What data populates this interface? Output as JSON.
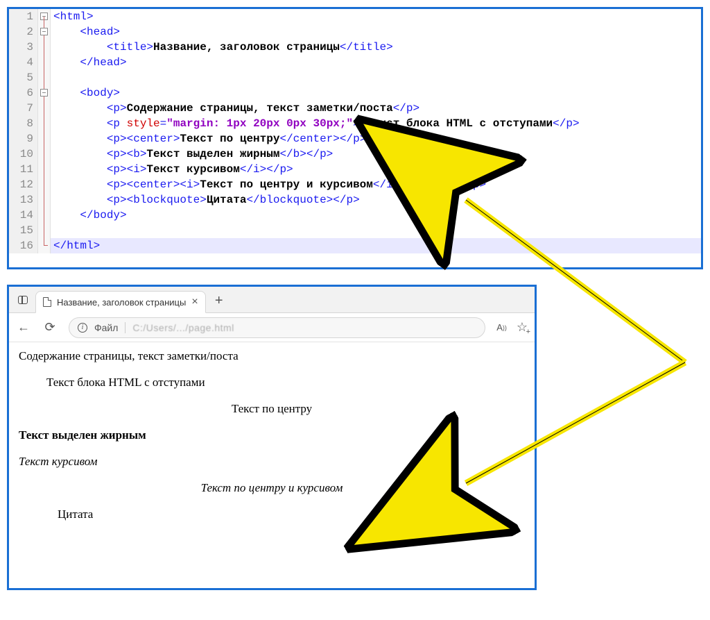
{
  "editor": {
    "lines": [
      {
        "n": "1",
        "html": "<span class='tag'>&lt;html&gt;</span>",
        "fold": "start"
      },
      {
        "n": "2",
        "html": "    <span class='tag'>&lt;head&gt;</span>",
        "fold": "start2"
      },
      {
        "n": "3",
        "html": "        <span class='tag'>&lt;title&gt;</span><span class='txt'>Название, заголовок страницы</span><span class='tag'>&lt;/title&gt;</span>",
        "fold": "mid"
      },
      {
        "n": "4",
        "html": "    <span class='tag'>&lt;/head&gt;</span>",
        "fold": "mid"
      },
      {
        "n": "5",
        "html": "",
        "fold": "mid"
      },
      {
        "n": "6",
        "html": "    <span class='tag'>&lt;body&gt;</span>",
        "fold": "start2"
      },
      {
        "n": "7",
        "html": "        <span class='tag'>&lt;p&gt;</span><span class='txt'>Содержание страницы, текст заметки/поста</span><span class='tag'>&lt;/p&gt;</span>",
        "fold": "mid"
      },
      {
        "n": "8",
        "html": "        <span class='tag'>&lt;p </span><span class='attr'>style</span><span class='tag'>=</span><span class='str'>\"margin: 1px 20px 0px 30px;\"</span><span class='tag'>&gt;</span><span class='txt'> Текст блока HTML с отступами</span><span class='tag'>&lt;/p&gt;</span>",
        "fold": "mid"
      },
      {
        "n": "9",
        "html": "        <span class='tag'>&lt;p&gt;&lt;center&gt;</span><span class='txt'>Текст по центру</span><span class='tag'>&lt;/center&gt;&lt;/p&gt;</span>",
        "fold": "mid"
      },
      {
        "n": "10",
        "html": "        <span class='tag'>&lt;p&gt;&lt;b&gt;</span><span class='txt'>Текст выделен жирным</span><span class='tag'>&lt;/b&gt;&lt;/p&gt;</span>",
        "fold": "mid"
      },
      {
        "n": "11",
        "html": "        <span class='tag'>&lt;p&gt;&lt;i&gt;</span><span class='txt'>Текст курсивом</span><span class='tag'>&lt;/i&gt;&lt;/p&gt;</span>",
        "fold": "mid"
      },
      {
        "n": "12",
        "html": "        <span class='tag'>&lt;p&gt;&lt;center&gt;&lt;i&gt;</span><span class='txt'>Текст по центру и курсивом</span><span class='tag'>&lt;/i&gt;&lt;/center&gt;&lt;/p&gt;</span>",
        "fold": "mid"
      },
      {
        "n": "13",
        "html": "        <span class='tag'>&lt;p&gt;&lt;blockquote&gt;</span><span class='txt'>Цитата</span><span class='tag'>&lt;/blockquote&gt;&lt;/p&gt;</span>",
        "fold": "mid"
      },
      {
        "n": "14",
        "html": "    <span class='tag'>&lt;/body&gt;</span>",
        "fold": "mid"
      },
      {
        "n": "15",
        "html": "",
        "fold": "mid"
      },
      {
        "n": "16",
        "html": "<span class='tag'>&lt;/html&gt;</span>",
        "fold": "end",
        "hl": true
      }
    ]
  },
  "browser": {
    "tab_title": "Название, заголовок страницы",
    "addr_label": "Файл",
    "addr_path": "C:/Users/.../page.html",
    "body": {
      "p1": "Содержание страницы, текст заметки/поста",
      "p2": "Текст блока HTML с отступами",
      "p3": "Текст по центру",
      "p4": "Текст выделен жирным",
      "p5": "Текст курсивом",
      "p6": "Текст по центру и курсивом",
      "p7": "Цитата"
    }
  }
}
